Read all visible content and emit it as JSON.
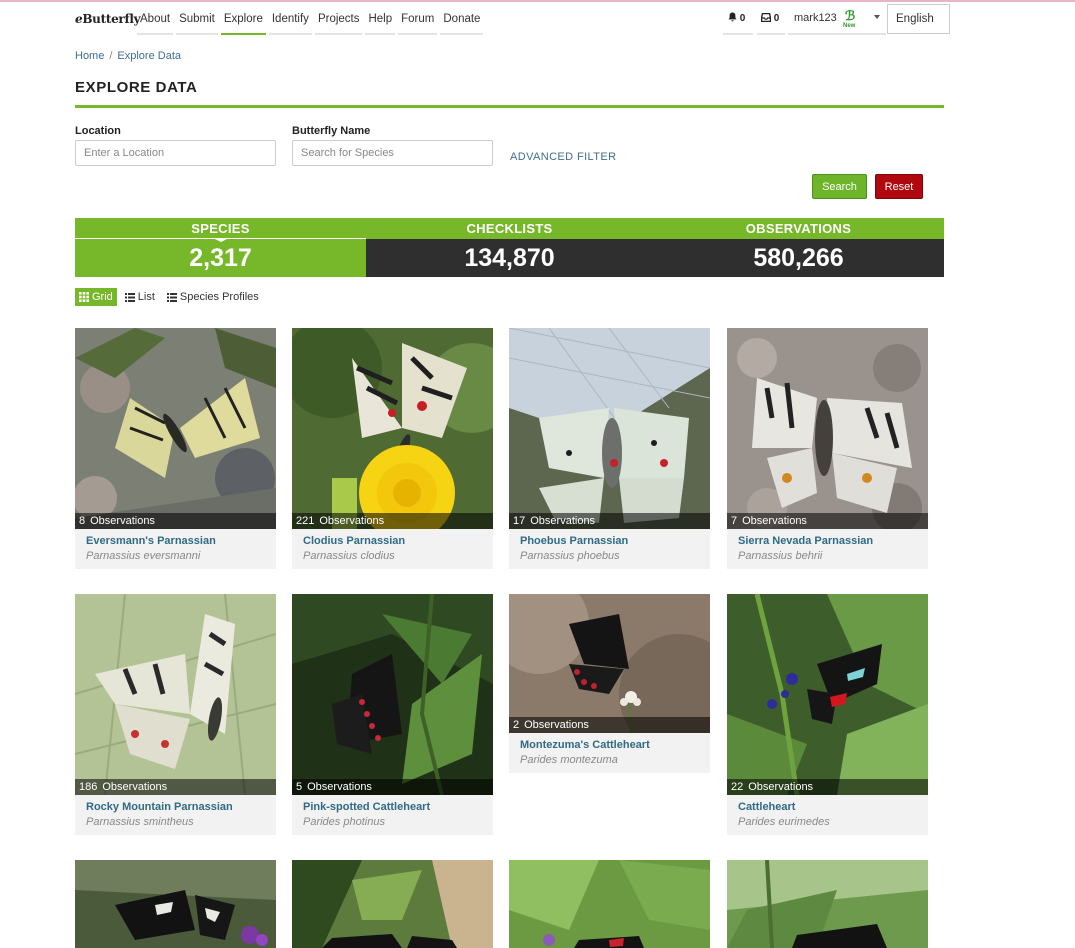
{
  "nav": {
    "logo_e": "e",
    "logo_rest": "Butterfly",
    "items": [
      "About",
      "Submit",
      "Explore",
      "Identify",
      "Projects",
      "Help",
      "Forum",
      "Donate"
    ],
    "active": "Explore",
    "notifications_count": "0",
    "messages_count": "0",
    "username": "mark123",
    "new_badge": "New",
    "language": "English"
  },
  "breadcrumb": {
    "home": "Home",
    "separator": "/",
    "current": "Explore Data"
  },
  "page_title": "EXPLORE DATA",
  "filters": {
    "location_label": "Location",
    "location_placeholder": "Enter a Location",
    "butterfly_label": "Butterfly Name",
    "butterfly_placeholder": "Search for Species",
    "advanced": "ADVANCED FILTER",
    "search_btn": "Search",
    "reset_btn": "Reset"
  },
  "stats": {
    "species_label": "SPECIES",
    "species_value": "2,317",
    "checklists_label": "CHECKLISTS",
    "checklists_value": "134,870",
    "observations_label": "OBSERVATIONS",
    "observations_value": "580,266"
  },
  "views": {
    "grid": "Grid",
    "list": "List",
    "profiles": "Species Profiles"
  },
  "obs_word": "Observations",
  "cards": [
    {
      "count": "8",
      "common": "Eversmann's Parnassian",
      "scientific": "Parnassius eversmanni"
    },
    {
      "count": "221",
      "common": "Clodius Parnassian",
      "scientific": "Parnassius clodius"
    },
    {
      "count": "17",
      "common": "Phoebus Parnassian",
      "scientific": "Parnassius phoebus"
    },
    {
      "count": "7",
      "common": "Sierra Nevada Parnassian",
      "scientific": "Parnassius behrii"
    },
    {
      "count": "186",
      "common": "Rocky Mountain Parnassian",
      "scientific": "Parnassius smintheus"
    },
    {
      "count": "5",
      "common": "Pink-spotted Cattleheart",
      "scientific": "Parides photinus"
    },
    {
      "count": "2",
      "common": "Montezuma's Cattleheart",
      "scientific": "Parides montezuma"
    },
    {
      "count": "22",
      "common": "Cattleheart",
      "scientific": "Parides eurimedes"
    }
  ],
  "colors": {
    "accent": "#77b82a",
    "dark": "#2f2f2f",
    "reset": "#b0080e",
    "link": "#2f6b85"
  }
}
